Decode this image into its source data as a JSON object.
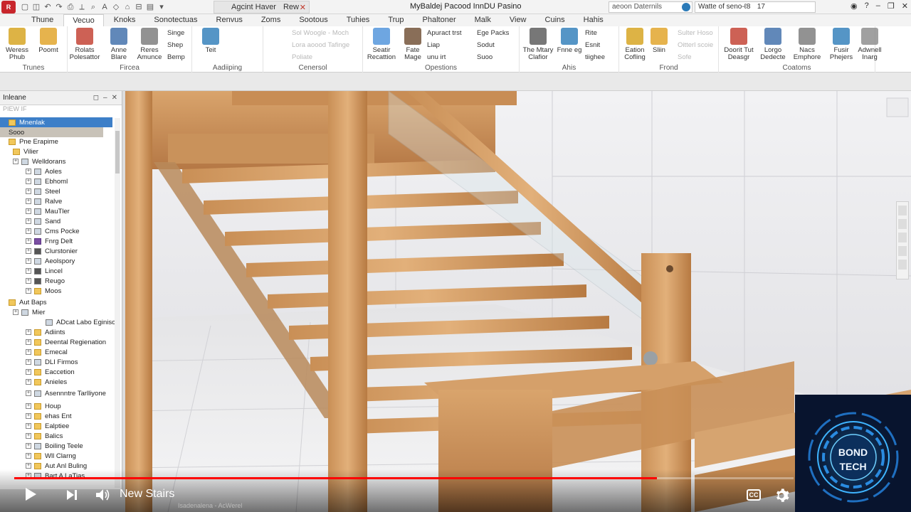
{
  "titlebar": {
    "doc_tab": "Agcint Haver",
    "doc_tab2": "Rew",
    "window_title": "MyBaldej Pacood InnDU Pasino",
    "search_placeholder": "aeoon Daternils",
    "search2_text": "Watte of seno-ℓ8",
    "search2_count": "17"
  },
  "ribbon": {
    "tabs": [
      "Thune",
      "Vecuo",
      "Knoks",
      "Sonotectuas",
      "Renvus",
      "Zoms",
      "Sootous",
      "Tuhies",
      "Trup",
      "Phaltoner",
      "Malk",
      "View",
      "Cuins",
      "Hahis"
    ],
    "active_tab_index": 1,
    "groups": [
      {
        "label": "Trunes",
        "buttons": [
          {
            "label": "Weress Phub"
          },
          {
            "label": "Poomt"
          }
        ]
      },
      {
        "label": "Fircea",
        "buttons": [
          {
            "label": "Rolats Polesattor"
          },
          {
            "label": "Anne Blare"
          },
          {
            "label": "Reres Amunce"
          },
          {
            "label": "Singe"
          },
          {
            "label": "Shep"
          },
          {
            "label": "Bemp"
          }
        ]
      },
      {
        "label": "Aadiiping",
        "buttons": [
          {
            "label": "Teit"
          }
        ]
      },
      {
        "label": "Cenersol",
        "buttons": [
          {
            "label": "Sol Woogle - Moch"
          },
          {
            "label": "Lora aoood Tafinge"
          },
          {
            "label": "Poliate"
          }
        ]
      },
      {
        "label": "Opestions",
        "buttons": [
          {
            "label": "Seatir Recattion"
          },
          {
            "label": "Fate Mage"
          },
          {
            "label": "Apuract trst"
          },
          {
            "label": "Liap"
          },
          {
            "label": "unu irt"
          },
          {
            "label": "Ege Packs"
          },
          {
            "label": "Sodut"
          },
          {
            "label": "Suoo"
          }
        ]
      },
      {
        "label": "Ahis",
        "buttons": [
          {
            "label": "The Mtary Clafior"
          },
          {
            "label": "Fnne eg"
          },
          {
            "label": "Rite"
          },
          {
            "label": "Esnit"
          },
          {
            "label": "tiighee"
          }
        ]
      },
      {
        "label": "Frond",
        "buttons": [
          {
            "label": "Eation Cofling"
          },
          {
            "label": "Sliin"
          },
          {
            "label": "Sulter Hoso"
          },
          {
            "label": "Oitterl scoie"
          },
          {
            "label": "Sofe"
          }
        ]
      },
      {
        "label": "Coatoms",
        "buttons": [
          {
            "label": "Doorit Tut Deasgr"
          },
          {
            "label": "Lorgo Dedecte"
          },
          {
            "label": "Nacs Emphore"
          },
          {
            "label": "Fusir Phejers"
          },
          {
            "label": "Adwnell Inarg"
          }
        ]
      }
    ]
  },
  "browser": {
    "title": "Inleane",
    "subtitle": "PIEW IF",
    "items": [
      {
        "label": "Mnenlak",
        "state": "selected"
      },
      {
        "label": "Sooo",
        "state": "sub"
      },
      {
        "label": "Pne Erapime"
      },
      {
        "label": "Vilier"
      },
      {
        "label": "Welldorans"
      },
      {
        "label": "Aoles"
      },
      {
        "label": "Ebhoml"
      },
      {
        "label": "Steel"
      },
      {
        "label": "Ralve"
      },
      {
        "label": "MauTler"
      },
      {
        "label": "Sand"
      },
      {
        "label": "Cms Pocke"
      },
      {
        "label": "Fnrg Delt"
      },
      {
        "label": "Clurstonier"
      },
      {
        "label": "Aeolspory"
      },
      {
        "label": "Lincel"
      },
      {
        "label": "Reugo"
      },
      {
        "label": "Moos"
      },
      {
        "label": "Aut Baps"
      },
      {
        "label": "Mier"
      },
      {
        "label": "ADcat Labo Eginiso"
      },
      {
        "label": "Adiints"
      },
      {
        "label": "Deental Regienation"
      },
      {
        "label": "Emecal"
      },
      {
        "label": "DLI Firmos"
      },
      {
        "label": "Eaccetion"
      },
      {
        "label": "Anieles"
      },
      {
        "label": "Asennntre Tarlliyone"
      },
      {
        "label": "Houp"
      },
      {
        "label": "ehas Ent"
      },
      {
        "label": "Ealptiee"
      },
      {
        "label": "Balics"
      },
      {
        "label": "Boiling Teele"
      },
      {
        "label": "Wll Clarng"
      },
      {
        "label": "Aut Anl Buling"
      },
      {
        "label": "Bart A LaTias"
      }
    ]
  },
  "video": {
    "title": "New Stairs",
    "progress": 0.825,
    "cc_label": "CC",
    "status_text": "Isadenalena - AcWerel"
  },
  "badge": {
    "line1": "BOND",
    "line2": "TECH"
  },
  "colors": {
    "accent": "#3d7fc8",
    "progress": "#ff0000",
    "badge_glow": "#2aa7ff"
  }
}
